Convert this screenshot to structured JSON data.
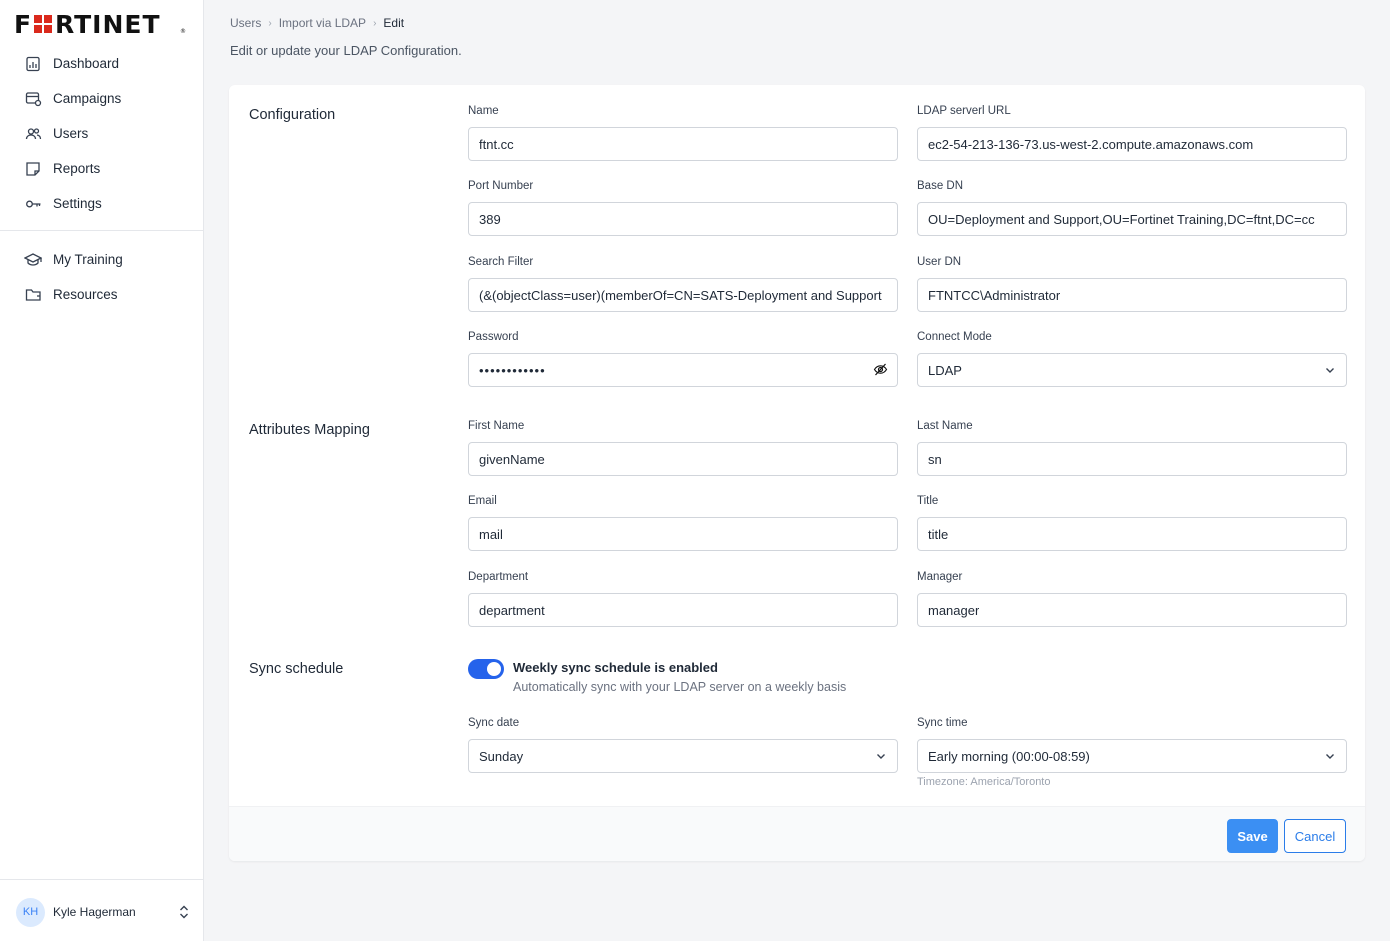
{
  "brand": {
    "logo_text": "F RTINET",
    "accent": "#3b8ff3",
    "logo_red": "#da291c"
  },
  "sidebar": {
    "primary": [
      {
        "label": "Dashboard",
        "icon": "dashboard-icon"
      },
      {
        "label": "Campaigns",
        "icon": "campaigns-icon"
      },
      {
        "label": "Users",
        "icon": "users-icon"
      },
      {
        "label": "Reports",
        "icon": "reports-icon"
      },
      {
        "label": "Settings",
        "icon": "settings-icon"
      }
    ],
    "secondary": [
      {
        "label": "My Training",
        "icon": "graduation-cap-icon"
      },
      {
        "label": "Resources",
        "icon": "folder-icon"
      }
    ],
    "user": {
      "initials": "KH",
      "name": "Kyle Hagerman"
    }
  },
  "breadcrumb": {
    "items": [
      "Users",
      "Import via LDAP"
    ],
    "current": "Edit"
  },
  "subtitle": "Edit or update your LDAP Configuration.",
  "sections": {
    "configuration": "Configuration",
    "attributes": "Attributes Mapping",
    "sync": "Sync schedule"
  },
  "config": {
    "name": {
      "label": "Name",
      "value": "ftnt.cc"
    },
    "ldap_url": {
      "label": "LDAP serverl URL",
      "value": "ec2-54-213-136-73.us-west-2.compute.amazonaws.com"
    },
    "port": {
      "label": "Port Number",
      "value": "389"
    },
    "base_dn": {
      "label": "Base DN",
      "value": "OU=Deployment and Support,OU=Fortinet Training,DC=ftnt,DC=cc"
    },
    "search_filter": {
      "label": "Search Filter",
      "value": "(&(objectClass=user)(memberOf=CN=SATS-Deployment and Support"
    },
    "user_dn": {
      "label": "User DN",
      "value": "FTNTCC\\Administrator"
    },
    "password": {
      "label": "Password",
      "value": "••••••••••••"
    },
    "connect_mode": {
      "label": "Connect Mode",
      "value": "LDAP"
    }
  },
  "attributes": {
    "first_name": {
      "label": "First Name",
      "value": "givenName"
    },
    "last_name": {
      "label": "Last Name",
      "value": "sn"
    },
    "email": {
      "label": "Email",
      "value": "mail"
    },
    "title": {
      "label": "Title",
      "value": "title"
    },
    "department": {
      "label": "Department",
      "value": "department"
    },
    "manager": {
      "label": "Manager",
      "value": "manager"
    }
  },
  "sync": {
    "toggle_title": "Weekly sync schedule is enabled",
    "toggle_desc": "Automatically sync with your LDAP server on a weekly basis",
    "enabled": true,
    "sync_date": {
      "label": "Sync date",
      "value": "Sunday"
    },
    "sync_time": {
      "label": "Sync time",
      "value": "Early morning (00:00-08:59)"
    },
    "timezone": "Timezone: America/Toronto"
  },
  "footer": {
    "save_label": "Save",
    "cancel_label": "Cancel"
  }
}
